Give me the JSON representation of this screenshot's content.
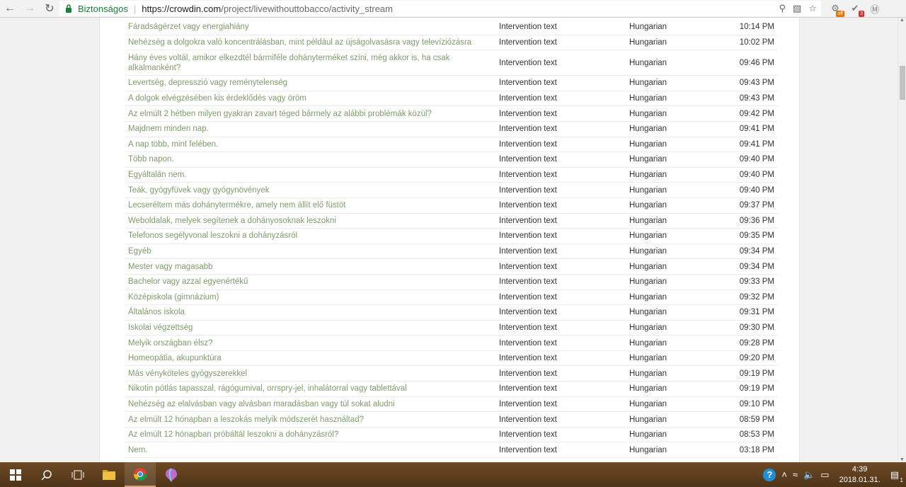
{
  "browser": {
    "secure_label": "Biztonságos",
    "url_host": "https://crowdin.com",
    "url_path": "/project/livewithouttobacco/activity_stream"
  },
  "rows": [
    {
      "text": "Fáradságérzet vagy energiahiány",
      "type": "Intervention text",
      "lang": "Hungarian",
      "time": "10:14 PM"
    },
    {
      "text": "Nehézség a dolgokra való koncentrálásban, mint például az újságolvasásra vagy televíziózásra",
      "type": "Intervention text",
      "lang": "Hungarian",
      "time": "10:02 PM"
    },
    {
      "text": "Hány éves voltál, amikor elkezdtél bármiféle dohányterméket színi, még akkor is, ha csak alkalmanként?",
      "type": "Intervention text",
      "lang": "Hungarian",
      "time": "09:46 PM",
      "tall": true
    },
    {
      "text": "Levertség, depresszió vagy reménytelenség",
      "type": "Intervention text",
      "lang": "Hungarian",
      "time": "09:43 PM"
    },
    {
      "text": "A dolgok elvégzésében kis érdeklődés vagy öröm",
      "type": "Intervention text",
      "lang": "Hungarian",
      "time": "09:43 PM"
    },
    {
      "text": "Az elmúlt 2 hétben milyen gyakran zavart téged bármely az alábbi problémák közül?",
      "type": "Intervention text",
      "lang": "Hungarian",
      "time": "09:42 PM"
    },
    {
      "text": "Majdnem minden nap.",
      "type": "Intervention text",
      "lang": "Hungarian",
      "time": "09:41 PM"
    },
    {
      "text": "A nap több, mint felében.",
      "type": "Intervention text",
      "lang": "Hungarian",
      "time": "09:41 PM"
    },
    {
      "text": "Több napon.",
      "type": "Intervention text",
      "lang": "Hungarian",
      "time": "09:40 PM"
    },
    {
      "text": "Egyáltalán nem.",
      "type": "Intervention text",
      "lang": "Hungarian",
      "time": "09:40 PM"
    },
    {
      "text": "Teák, gyógyfüvek vagy gyógynövények",
      "type": "Intervention text",
      "lang": "Hungarian",
      "time": "09:40 PM"
    },
    {
      "text": "Lecseréltem más dohánytermékre, amely nem állít elő füstöt",
      "type": "Intervention text",
      "lang": "Hungarian",
      "time": "09:37 PM"
    },
    {
      "text": "Weboldalak, melyek segítenek a dohányosoknak leszokni",
      "type": "Intervention text",
      "lang": "Hungarian",
      "time": "09:36 PM"
    },
    {
      "text": "Telefonos segélyvonal leszokni a dohányzásról",
      "type": "Intervention text",
      "lang": "Hungarian",
      "time": "09:35 PM"
    },
    {
      "text": "Egyéb",
      "type": "Intervention text",
      "lang": "Hungarian",
      "time": "09:34 PM"
    },
    {
      "text": "Mester vagy magasabb",
      "type": "Intervention text",
      "lang": "Hungarian",
      "time": "09:34 PM"
    },
    {
      "text": "Bachelor vagy azzal egyenértékű",
      "type": "Intervention text",
      "lang": "Hungarian",
      "time": "09:33 PM"
    },
    {
      "text": "Középiskola (gimnázium)",
      "type": "Intervention text",
      "lang": "Hungarian",
      "time": "09:32 PM"
    },
    {
      "text": "Általános iskola",
      "type": "Intervention text",
      "lang": "Hungarian",
      "time": "09:31 PM"
    },
    {
      "text": "Iskolai végzettség",
      "type": "Intervention text",
      "lang": "Hungarian",
      "time": "09:30 PM"
    },
    {
      "text": "Melyik országban élsz?",
      "type": "Intervention text",
      "lang": "Hungarian",
      "time": "09:28 PM"
    },
    {
      "text": "Homeopátia, akupunktúra",
      "type": "Intervention text",
      "lang": "Hungarian",
      "time": "09:20 PM"
    },
    {
      "text": "Más vényköteles gyógyszerekkel",
      "type": "Intervention text",
      "lang": "Hungarian",
      "time": "09:19 PM"
    },
    {
      "text": "Nikotin pótlás tapasszal, rágógumival, orrspry-jel, inhalátorral vagy tablettával",
      "type": "Intervention text",
      "lang": "Hungarian",
      "time": "09:19 PM"
    },
    {
      "text": "Nehézség az elalvásban vagy alvásban maradásban vagy túl sokat aludni",
      "type": "Intervention text",
      "lang": "Hungarian",
      "time": "09:10 PM"
    },
    {
      "text": "Az elmúlt 12 hónapban a leszokás melyik módszerét használtad?",
      "type": "Intervention text",
      "lang": "Hungarian",
      "time": "08:59 PM"
    },
    {
      "text": "Az elmúlt 12 hónapban próbáltál leszokni a dohányzásról?",
      "type": "Intervention text",
      "lang": "Hungarian",
      "time": "08:53 PM"
    },
    {
      "text": "Nem.",
      "type": "Intervention text",
      "lang": "Hungarian",
      "time": "03:18 PM"
    }
  ],
  "taskbar": {
    "time": "4:39",
    "date": "2018.01.31.",
    "notification_count": "1"
  },
  "icons": [
    "back-icon",
    "forward-icon",
    "reload-icon",
    "lock-icon",
    "zoom-icon",
    "translate-icon",
    "star-icon",
    "windows-start-icon",
    "search-icon",
    "task-view-icon",
    "file-explorer-icon",
    "chrome-icon",
    "app-icon",
    "help-icon",
    "notification-icon"
  ]
}
